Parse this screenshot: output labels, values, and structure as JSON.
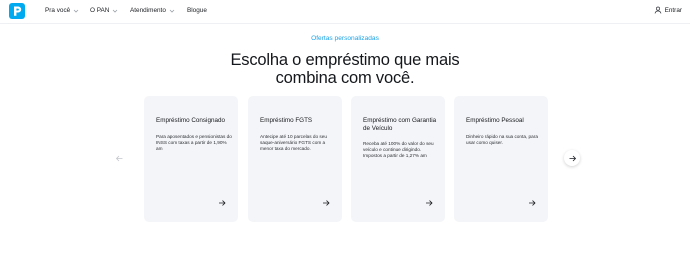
{
  "nav": {
    "items": [
      {
        "label": "Pra você",
        "has_dropdown": true
      },
      {
        "label": "O PAN",
        "has_dropdown": true
      },
      {
        "label": "Atendimento",
        "has_dropdown": true
      },
      {
        "label": "Blogue",
        "has_dropdown": false
      }
    ],
    "login_label": "Entrar"
  },
  "section": {
    "kicker": "Ofertas personalizadas",
    "headline_line1": "Escolha o empréstimo que mais",
    "headline_line2": "combina com você."
  },
  "cards": [
    {
      "title": "Empréstimo Consignado",
      "description": "Para aposentados e pensionistas do INSS com taxas a partir de 1,90% am"
    },
    {
      "title": "Empréstimo FGTS",
      "description": "Antecipe até 10 parcelas do seu saque-aniversário FGTS com a menor taxa do mercado."
    },
    {
      "title": "Empréstimo com Garantia de Veículo",
      "description": "Receba até 100% do valor do seu veículo e continue dirigindo. Impostos a partir de 1,27% am"
    },
    {
      "title": "Empréstimo Pessoal",
      "description": "Dinheiro rápido na sua conta, para usar como quiser."
    }
  ],
  "colors": {
    "brand": "#00aaf0",
    "card_bg": "#f4f5f8",
    "kicker": "#1aa3e8"
  },
  "icons": {
    "logo": "pan-logo-icon",
    "user": "user-icon",
    "card_arrow": "arrow-right-icon",
    "prev": "arrow-left-icon",
    "next": "arrow-right-icon"
  }
}
